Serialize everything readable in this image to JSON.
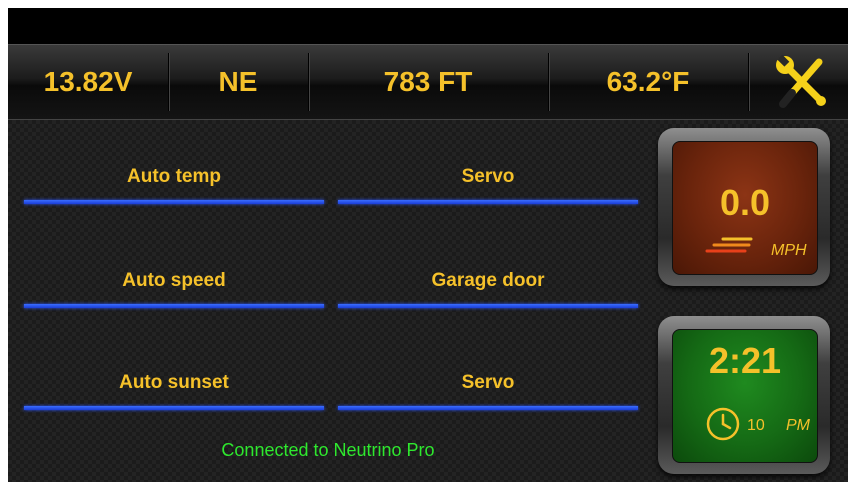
{
  "status_bar": {
    "voltage": "13.82V",
    "heading": "NE",
    "altitude": "783 FT",
    "temperature": "63.2°F",
    "settings_icon": "tools-icon"
  },
  "buttons": [
    {
      "label": "Auto temp"
    },
    {
      "label": "Servo"
    },
    {
      "label": "Auto speed"
    },
    {
      "label": "Garage door"
    },
    {
      "label": "Auto sunset"
    },
    {
      "label": "Servo"
    }
  ],
  "speed_gauge": {
    "value": "0.0",
    "unit": "MPH",
    "icon": "speed-lines-icon"
  },
  "clock_gauge": {
    "time": "2:21",
    "hour_hint": "10",
    "meridiem": "PM",
    "icon": "clock-icon"
  },
  "footer": {
    "connection_status": "Connected to Neutrino Pro"
  },
  "colors": {
    "accent_text": "#f5c12a",
    "underline": "#2b55ff",
    "status_text": "#2ee82e"
  }
}
